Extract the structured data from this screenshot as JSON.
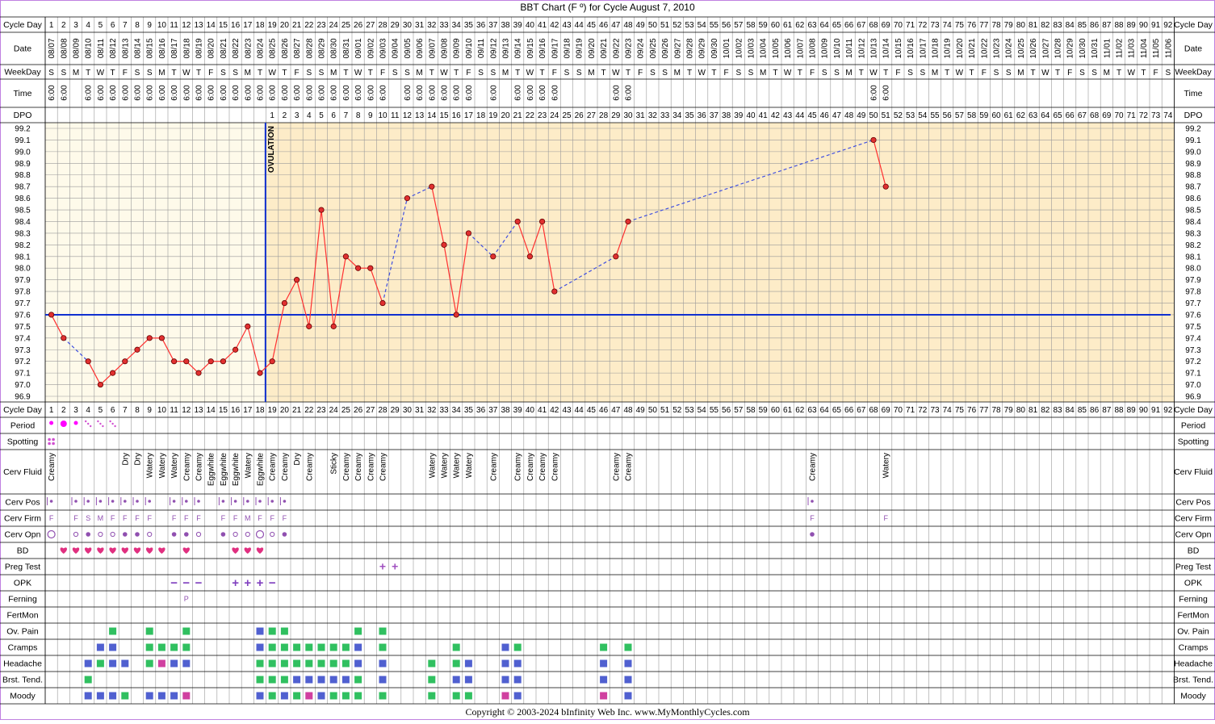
{
  "title": "BBT Chart (F º) for Cycle August 7, 2010",
  "footer": "Copyright © 2003-2024 bInfinity Web Inc.     www.MyMonthlyCycles.com",
  "row_labels": {
    "cycle_day": "Cycle Day",
    "date": "Date",
    "weekday": "WeekDay",
    "time": "Time",
    "dpo": "DPO",
    "period": "Period",
    "spotting": "Spotting",
    "cerv_fluid": "Cerv Fluid",
    "cerv_pos": "Cerv Pos",
    "cerv_firm": "Cerv Firm",
    "cerv_opn": "Cerv Opn",
    "bd": "BD",
    "preg_test": "Preg Test",
    "opk": "OPK",
    "ferning": "Ferning",
    "fertmon": "FertMon",
    "ov_pain": "Ov. Pain",
    "cramps": "Cramps",
    "headache": "Headache",
    "brst_tend": "Brst. Tend.",
    "moody": "Moody"
  },
  "ovulation_label": "OVULATION",
  "colors": {
    "page_border": "#c080e0",
    "grid": "#9a9a9a",
    "pre_bg": "#fefaea",
    "post_bg": "#fdecc8",
    "line": "#ff3030",
    "dot_fill": "#e03030",
    "coverline": "#1030d0",
    "ovulation": "#1030d0",
    "period": "#ff00ff",
    "spotting": "#d050d0",
    "cerv": "#9050b0",
    "bd": "#e03080",
    "preg": "#a050c0",
    "opk": "#8040c0",
    "green": "#30c060",
    "blue": "#5060d0",
    "pink": "#d040a0"
  },
  "chart_data": {
    "type": "line",
    "title": "BBT Chart (F º) for Cycle August 7, 2010",
    "cycle_days": [
      1,
      2,
      3,
      4,
      5,
      6,
      7,
      8,
      9,
      10,
      11,
      12,
      13,
      14,
      15,
      16,
      17,
      18,
      19,
      20,
      21,
      22,
      23,
      24,
      25,
      26,
      27,
      28,
      29,
      30,
      31,
      32,
      33,
      34,
      35,
      36,
      37,
      38,
      39,
      40,
      41,
      42,
      43,
      44,
      45,
      46,
      47,
      48,
      49,
      50,
      51,
      52,
      53,
      54,
      55,
      56,
      57,
      58,
      59,
      60,
      61,
      62,
      63,
      64,
      65,
      66,
      67,
      68,
      69,
      70,
      71,
      72,
      73,
      74,
      75,
      76,
      77,
      78,
      79,
      80,
      81,
      82,
      83,
      84,
      85,
      86,
      87,
      88,
      89,
      90,
      91,
      92
    ],
    "dates": [
      "08/07",
      "08/08",
      "08/09",
      "08/10",
      "08/11",
      "08/12",
      "08/13",
      "08/14",
      "08/15",
      "08/16",
      "08/17",
      "08/18",
      "08/19",
      "08/20",
      "08/21",
      "08/22",
      "08/23",
      "08/24",
      "08/25",
      "08/26",
      "08/27",
      "08/28",
      "08/29",
      "08/30",
      "08/31",
      "09/01",
      "09/02",
      "09/03",
      "09/04",
      "09/05",
      "09/06",
      "09/07",
      "09/08",
      "09/09",
      "09/10",
      "09/11",
      "09/12",
      "09/13",
      "09/14",
      "09/15",
      "09/16",
      "09/17",
      "09/18",
      "09/19",
      "09/20",
      "09/21",
      "09/22",
      "09/23",
      "09/24",
      "09/25",
      "09/26",
      "09/27",
      "09/28",
      "09/29",
      "09/30",
      "10/01",
      "10/02",
      "10/03",
      "10/04",
      "10/05",
      "10/06",
      "10/07",
      "10/08",
      "10/09",
      "10/10",
      "10/11",
      "10/12",
      "10/13",
      "10/14",
      "10/15",
      "10/16",
      "10/17",
      "10/18",
      "10/19",
      "10/20",
      "10/21",
      "10/22",
      "10/23",
      "10/24",
      "10/25",
      "10/26",
      "10/27",
      "10/28",
      "10/29",
      "10/30",
      "10/31",
      "11/01",
      "11/02",
      "11/03",
      "11/04",
      "11/05",
      "11/06"
    ],
    "weekdays": [
      "S",
      "S",
      "M",
      "T",
      "W",
      "T",
      "F",
      "S",
      "S",
      "M",
      "T",
      "W",
      "T",
      "F",
      "S",
      "S",
      "M",
      "T",
      "W",
      "T",
      "F",
      "S",
      "S",
      "M",
      "T",
      "W",
      "T",
      "F",
      "S",
      "S",
      "M",
      "T",
      "W",
      "T",
      "F",
      "S",
      "S",
      "M",
      "T",
      "W",
      "T",
      "F",
      "S",
      "S",
      "M",
      "T",
      "W",
      "T",
      "F",
      "S",
      "S",
      "M",
      "T",
      "W",
      "T",
      "F",
      "S",
      "S",
      "M",
      "T",
      "W",
      "T",
      "F",
      "S",
      "S",
      "M",
      "T",
      "W",
      "T",
      "F",
      "S",
      "S",
      "M",
      "T",
      "W",
      "T",
      "F",
      "S",
      "S",
      "M",
      "T",
      "W",
      "T",
      "F",
      "S",
      "S",
      "M",
      "T",
      "W",
      "T",
      "F",
      "S"
    ],
    "times": [
      "6:00",
      "6:00",
      "",
      "6:00",
      "6:00",
      "6:00",
      "6:00",
      "6:00",
      "6:00",
      "6:00",
      "6:00",
      "6:00",
      "6:00",
      "6:00",
      "6:00",
      "6:00",
      "6:00",
      "6:00",
      "6:00",
      "6:00",
      "6:00",
      "6:00",
      "6:00",
      "6:00",
      "6:00",
      "6:00",
      "6:00",
      "6:00",
      "",
      "6:00",
      "6:00",
      "6:00",
      "6:00",
      "6:00",
      "6:00",
      "",
      "6:00",
      "",
      "6:00",
      "6:00",
      "6:00",
      "6:00",
      "",
      "",
      "",
      "",
      "6:00",
      "6:00",
      "",
      "",
      "",
      "",
      "",
      "",
      "",
      "",
      "",
      "",
      "",
      "",
      "",
      "",
      "",
      "",
      "",
      "",
      "",
      "6:00",
      "6:00",
      "",
      "",
      "",
      "",
      "",
      "",
      "",
      "",
      "",
      "",
      "",
      "",
      "",
      "",
      "",
      "",
      "",
      "",
      "",
      "",
      "",
      "",
      ""
    ],
    "dpo": [
      "",
      "",
      "",
      "",
      "",
      "",
      "",
      "",
      "",
      "",
      "",
      "",
      "",
      "",
      "",
      "",
      "",
      "",
      "1",
      "2",
      "3",
      "4",
      "5",
      "6",
      "7",
      "8",
      "9",
      "10",
      "11",
      "12",
      "13",
      "14",
      "15",
      "16",
      "17",
      "18",
      "19",
      "20",
      "21",
      "22",
      "23",
      "24",
      "25",
      "26",
      "27",
      "28",
      "29",
      "30",
      "31",
      "32",
      "33",
      "34",
      "35",
      "36",
      "37",
      "38",
      "39",
      "40",
      "41",
      "42",
      "43",
      "44",
      "45",
      "46",
      "47",
      "48",
      "49",
      "50",
      "51",
      "52",
      "53",
      "54",
      "55",
      "56",
      "57",
      "58",
      "59",
      "60",
      "61",
      "62",
      "63",
      "64",
      "65",
      "66",
      "67",
      "68",
      "69",
      "70",
      "71",
      "72",
      "73",
      "74"
    ],
    "temps": [
      97.6,
      97.4,
      null,
      97.2,
      97.0,
      97.1,
      97.2,
      97.3,
      97.4,
      97.4,
      97.2,
      97.2,
      97.1,
      97.2,
      97.2,
      97.3,
      97.5,
      97.1,
      97.2,
      97.7,
      97.9,
      97.5,
      98.5,
      97.5,
      98.1,
      98.0,
      98.0,
      97.7,
      null,
      98.6,
      null,
      98.7,
      98.2,
      97.6,
      98.3,
      null,
      98.1,
      null,
      98.4,
      98.1,
      98.4,
      97.8,
      null,
      null,
      null,
      null,
      98.1,
      98.4,
      null,
      null,
      null,
      null,
      null,
      null,
      null,
      null,
      null,
      null,
      null,
      null,
      null,
      null,
      null,
      null,
      null,
      null,
      null,
      99.1,
      98.7,
      null,
      null,
      null,
      null,
      null,
      null,
      null,
      null,
      null,
      null,
      null,
      null,
      null,
      null,
      null,
      null,
      null,
      null,
      null,
      null,
      null,
      null,
      null
    ],
    "ylim": [
      96.9,
      99.2
    ],
    "yticks": [
      "99.2",
      "99.1",
      "99.0",
      "98.9",
      "98.8",
      "98.7",
      "98.6",
      "98.5",
      "98.4",
      "98.3",
      "98.2",
      "98.1",
      "98.0",
      "97.9",
      "97.8",
      "97.7",
      "97.6",
      "97.5",
      "97.4",
      "97.3",
      "97.2",
      "97.1",
      "97.0",
      "96.9"
    ],
    "coverline": 97.6,
    "ovulation_day": 18,
    "grid": true
  },
  "rows": {
    "period": {
      "1": "dot-s",
      "2": "dot-l",
      "3": "dot-s",
      "4": "dots",
      "5": "dots",
      "6": "dots"
    },
    "spotting": {
      "1": "sq4"
    },
    "cerv_fluid": {
      "1": "Creamy",
      "7": "Dry",
      "8": "Dry",
      "9": "Watery",
      "10": "Watery",
      "11": "Watery",
      "12": "Creamy",
      "13": "Creamy",
      "14": "Eggwhite",
      "15": "Eggwhite",
      "16": "Eggwhite",
      "17": "Watery",
      "18": "Eggwhite",
      "19": "Creamy",
      "20": "Creamy",
      "21": "Dry",
      "22": "Creamy",
      "24": "Sticky",
      "25": "Creamy",
      "26": "Creamy",
      "27": "Creamy",
      "28": "Creamy",
      "32": "Watery",
      "33": "Watery",
      "34": "Watery",
      "35": "Watery",
      "37": "Creamy",
      "39": "Creamy",
      "40": "Creamy",
      "41": "Creamy",
      "42": "Creamy",
      "47": "Creamy",
      "48": "Creamy",
      "63": "Creamy",
      "69": "Watery"
    },
    "cerv_pos": [
      "1",
      "3",
      "4",
      "5",
      "6",
      "7",
      "8",
      "9",
      "11",
      "12",
      "13",
      "15",
      "16",
      "17",
      "18",
      "19",
      "20",
      "63"
    ],
    "cerv_firm": {
      "1": "F",
      "3": "F",
      "4": "S",
      "5": "M",
      "6": "F",
      "7": "F",
      "8": "F",
      "9": "F",
      "11": "F",
      "12": "F",
      "13": "F",
      "15": "F",
      "16": "F",
      "17": "M",
      "18": "F",
      "19": "F",
      "20": "F",
      "63": "F",
      "69": "F"
    },
    "cerv_opn": {
      "1": "big",
      "3": "s",
      "4": "f",
      "5": "s",
      "6": "s",
      "7": "f",
      "8": "f",
      "9": "s",
      "11": "f",
      "12": "f",
      "13": "s",
      "15": "f",
      "16": "s",
      "17": "s",
      "18": "big",
      "19": "s",
      "20": "f",
      "63": "f"
    },
    "bd": [
      "2",
      "3",
      "4",
      "5",
      "6",
      "7",
      "8",
      "9",
      "10",
      "12",
      "16",
      "17",
      "18"
    ],
    "preg_test": {
      "28": "+",
      "29": "+"
    },
    "opk": {
      "11": "−",
      "12": "−",
      "13": "−",
      "16": "+",
      "17": "+",
      "18": "+",
      "19": "−"
    },
    "ferning": {
      "12": "P"
    },
    "ov_pain": {
      "6": "g",
      "9": "g",
      "12": "g",
      "18": "b",
      "19": "g",
      "20": "g",
      "26": "g",
      "28": "g"
    },
    "cramps": {
      "5": "b",
      "6": "b",
      "9": "g",
      "10": "g",
      "11": "g",
      "12": "g",
      "18": "b",
      "19": "g",
      "20": "g",
      "21": "g",
      "22": "g",
      "23": "g",
      "24": "g",
      "25": "g",
      "26": "b",
      "28": "g",
      "34": "g",
      "38": "b",
      "39": "g",
      "46": "g",
      "48": "g"
    },
    "headache": {
      "4": "b",
      "5": "g",
      "6": "b",
      "7": "b",
      "9": "g",
      "10": "p",
      "11": "b",
      "12": "b",
      "18": "g",
      "19": "g",
      "20": "g",
      "21": "g",
      "22": "g",
      "23": "g",
      "24": "g",
      "25": "g",
      "26": "b",
      "28": "b",
      "32": "g",
      "34": "g",
      "35": "b",
      "38": "b",
      "39": "b",
      "46": "b",
      "48": "b"
    },
    "brst_tend": {
      "4": "g",
      "18": "g",
      "19": "g",
      "20": "g",
      "21": "b",
      "22": "b",
      "23": "b",
      "24": "b",
      "25": "b",
      "26": "g",
      "28": "b",
      "32": "g",
      "34": "b",
      "35": "b",
      "38": "b",
      "39": "b",
      "46": "b",
      "48": "b"
    },
    "moody": {
      "4": "b",
      "5": "b",
      "6": "b",
      "7": "g",
      "9": "b",
      "10": "b",
      "11": "b",
      "12": "p",
      "18": "b",
      "19": "g",
      "20": "b",
      "21": "g",
      "22": "p",
      "23": "b",
      "24": "g",
      "25": "g",
      "26": "g",
      "28": "g",
      "32": "g",
      "34": "g",
      "35": "g",
      "38": "p",
      "39": "b",
      "46": "p",
      "48": "b"
    }
  }
}
